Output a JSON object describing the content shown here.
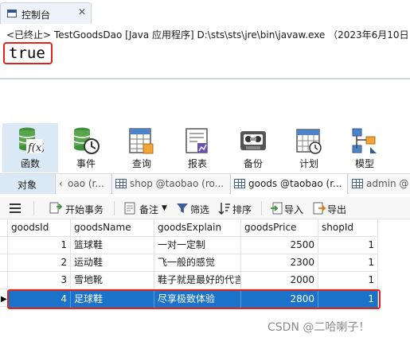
{
  "console": {
    "tab_label": "控制台",
    "close_glyph": "✕",
    "status_line": "<已终止> TestGoodsDao [Java 应用程序] D:\\sts\\sts\\jre\\bin\\javaw.exe （2023年6月10日 下",
    "output_text": "true"
  },
  "toolbar": {
    "items": [
      {
        "label": "函数",
        "icon": "function-icon"
      },
      {
        "label": "事件",
        "icon": "event-icon"
      },
      {
        "label": "查询",
        "icon": "query-icon"
      },
      {
        "label": "报表",
        "icon": "report-icon"
      },
      {
        "label": "备份",
        "icon": "backup-icon"
      },
      {
        "label": "计划",
        "icon": "schedule-icon"
      },
      {
        "label": "模型",
        "icon": "model-icon"
      }
    ]
  },
  "tabs": {
    "objects": "对象",
    "items": [
      {
        "label": "oao (r..."
      },
      {
        "label": "shop @taobao (ro..."
      },
      {
        "label": "goods @taobao (r..."
      },
      {
        "label": "admin @"
      }
    ]
  },
  "grid_toolbar": {
    "begin_tx": "开始事务",
    "note": "备注",
    "filter": "筛选",
    "sort": "排序",
    "import": "导入",
    "export": "导出"
  },
  "table": {
    "columns": [
      "goodsId",
      "goodsName",
      "goodsExplain",
      "goodsPrice",
      "shopId"
    ],
    "rows": [
      [
        "1",
        "篮球鞋",
        "一对一定制",
        "2500",
        "1"
      ],
      [
        "2",
        "运动鞋",
        "飞一般的感觉",
        "2300",
        "1"
      ],
      [
        "3",
        "雪地靴",
        "鞋子就是最好的代言",
        "2000",
        "1"
      ],
      [
        "4",
        "足球鞋",
        "尽享极致体验",
        "2800",
        "1"
      ]
    ],
    "selected_row": 4
  },
  "watermark": "CSDN @二哈喇子！",
  "colors": {
    "highlight_red": "#e0231b",
    "selection_blue": "#1a73c8",
    "navicat_blue": "#34548a"
  }
}
